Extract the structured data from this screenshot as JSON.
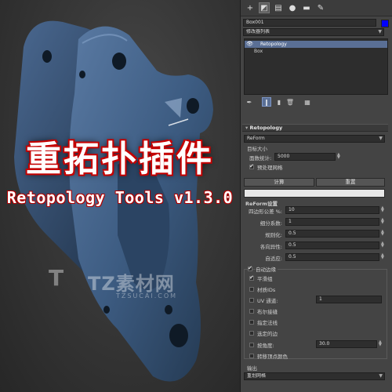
{
  "promo": {
    "title": "重拓扑插件",
    "subtitle": "Retopology Tools v1.3.0",
    "watermark_logo": "T",
    "watermark_text": "TZ素材网",
    "watermark_sub": "TZSUCAI.COM",
    "model_color": "#3d5c82"
  },
  "panel": {
    "tabs": [
      "plus-icon",
      "modify-icon",
      "hierarchy-icon",
      "motion-icon",
      "display-icon",
      "utilities-icon"
    ],
    "object_name": "Box001",
    "object_color": "#0000ff",
    "modifier_list_label": "修改器列表",
    "stack": [
      {
        "label": "Retopology",
        "selected": true
      },
      {
        "label": "Box",
        "selected": false
      }
    ],
    "retopology": {
      "header": "Retopology",
      "method_value": "ReForm",
      "target_size_label": "目标大小",
      "face_count_label": "面数统计:",
      "face_count_value": "5000",
      "preprocess_label": "预处理网格",
      "compute_button": "计算",
      "reset_button": "重置",
      "progress": 1.0
    },
    "reform": {
      "header": "ReForm设置",
      "quad_tolerance_label": "四边形公差 %:",
      "quad_tolerance_value": "10",
      "subdivision_label": "细分系数:",
      "subdivision_value": "1",
      "regularize_label": "规则化:",
      "regularize_value": "0.5",
      "anisotropy_label": "各向异性:",
      "anisotropy_value": "0.5",
      "adaptive_label": "自适应:",
      "adaptive_value": "0.5"
    },
    "edges": {
      "auto_edges_label": "自动边缘",
      "smooth_groups_label": "平滑组",
      "material_ids_label": "材质IDs",
      "uv_channel_label": "UV 通道:",
      "uv_channel_value": "1",
      "boolean_seams_label": "布尔接缝",
      "specified_normals_label": "指定法线",
      "selected_edges_label": "选定的边",
      "by_angle_label": "按角度:",
      "by_angle_value": "30.0",
      "vertex_color_label": "转移顶点颜色"
    },
    "output": {
      "label": "输出",
      "value": "重划网格"
    }
  }
}
